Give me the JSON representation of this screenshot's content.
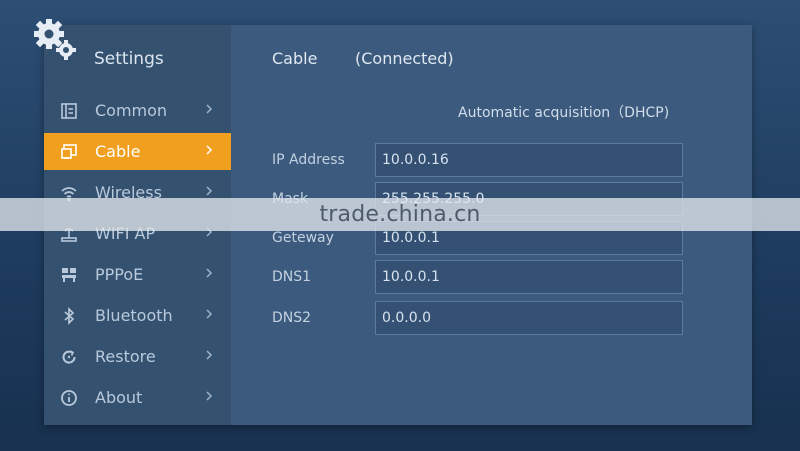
{
  "sidebar": {
    "title": "Settings",
    "items": [
      {
        "label": "Common",
        "icon": "common-settings-icon",
        "active": false
      },
      {
        "label": "Cable",
        "icon": "ethernet-icon",
        "active": true
      },
      {
        "label": "Wireless",
        "icon": "wifi-icon",
        "active": false
      },
      {
        "label": "WIFI AP",
        "icon": "wifi-ap-icon",
        "active": false
      },
      {
        "label": "PPPoE",
        "icon": "pppoe-icon",
        "active": false
      },
      {
        "label": "Bluetooth",
        "icon": "bluetooth-icon",
        "active": false
      },
      {
        "label": "Restore",
        "icon": "restore-icon",
        "active": false
      },
      {
        "label": "About",
        "icon": "info-icon",
        "active": false
      }
    ]
  },
  "main": {
    "header": "Cable",
    "status": "(Connected)",
    "mode": "Automatic acquisition（DHCP)",
    "fields": [
      {
        "label": "IP Address",
        "value": "10.0.0.16"
      },
      {
        "label": "Mask",
        "value": "255.255.255.0"
      },
      {
        "label": "Geteway",
        "value": "10.0.0.1"
      },
      {
        "label": "DNS1",
        "value": "10.0.0.1"
      },
      {
        "label": "DNS2",
        "value": "0.0.0.0"
      }
    ]
  },
  "watermark": "trade.china.cn",
  "colors": {
    "accent": "#f0a01e",
    "panel": "#3b5a7e",
    "sidebar": "#34526f"
  }
}
